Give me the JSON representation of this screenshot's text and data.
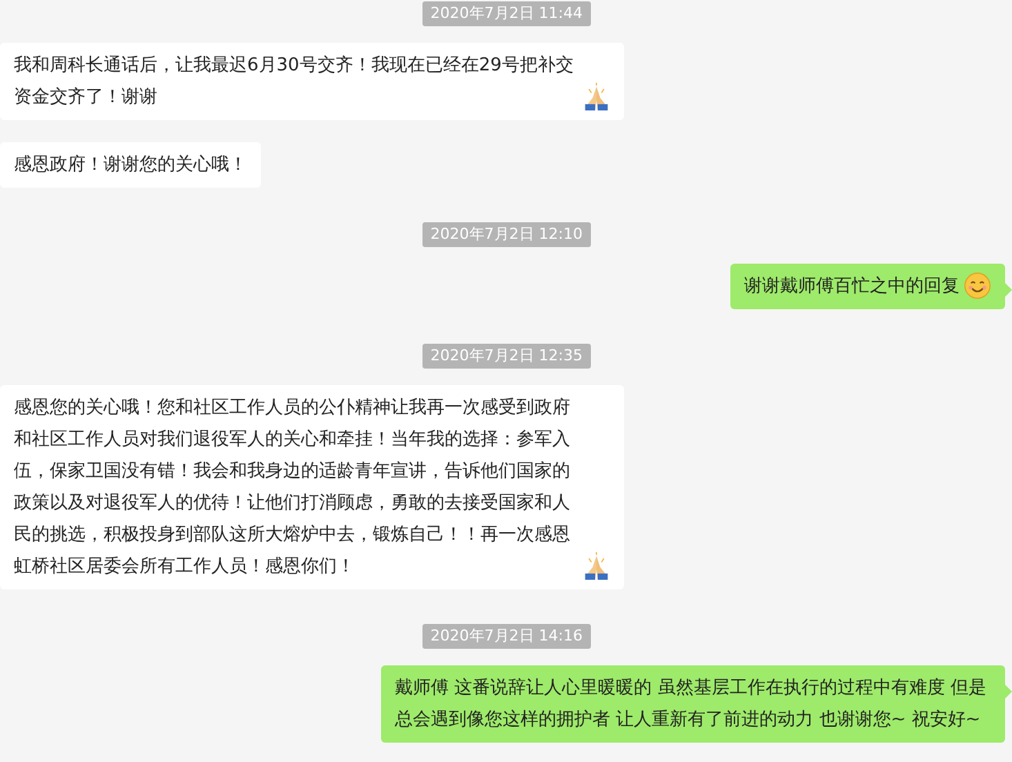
{
  "messages": [
    {
      "kind": "time",
      "text": "2020年7月2日 11:44"
    },
    {
      "kind": "received",
      "text": "我和周科长通话后，让我最迟6月30号交齐！我现在已经在29号把补交资金交齐了！谢谢",
      "emoji": {
        "kind": "pray"
      }
    },
    {
      "kind": "received",
      "text": "感恩政府！谢谢您的关心哦！"
    },
    {
      "kind": "time",
      "text": "2020年7月2日 12:10"
    },
    {
      "kind": "sent",
      "text": "谢谢戴师傅百忙之中的回复",
      "emoji": {
        "kind": "smile"
      }
    },
    {
      "kind": "time",
      "text": "2020年7月2日 12:35"
    },
    {
      "kind": "received",
      "text": "感恩您的关心哦！您和社区工作人员的公仆精神让我再一次感受到政府和社区工作人员对我们退役军人的关心和牵挂！当年我的选择：参军入伍，保家卫国没有错！我会和我身边的适龄青年宣讲，告诉他们国家的政策以及对退役军人的优待！让他们打消顾虑，勇敢的去接受国家和人民的挑选，积极投身到部队这所大熔炉中去，锻炼自己！！再一次感恩虹桥社区居委会所有工作人员！感恩你们！",
      "emoji": {
        "kind": "pray"
      }
    },
    {
      "kind": "time",
      "text": "2020年7月2日 14:16"
    },
    {
      "kind": "sent",
      "text": "戴师傅 这番说辞让人心里暖暖的 虽然基层工作在执行的过程中有难度 但是总会遇到像您这样的拥护者 让人重新有了前进的动力 也谢谢您~ 祝安好~"
    }
  ]
}
